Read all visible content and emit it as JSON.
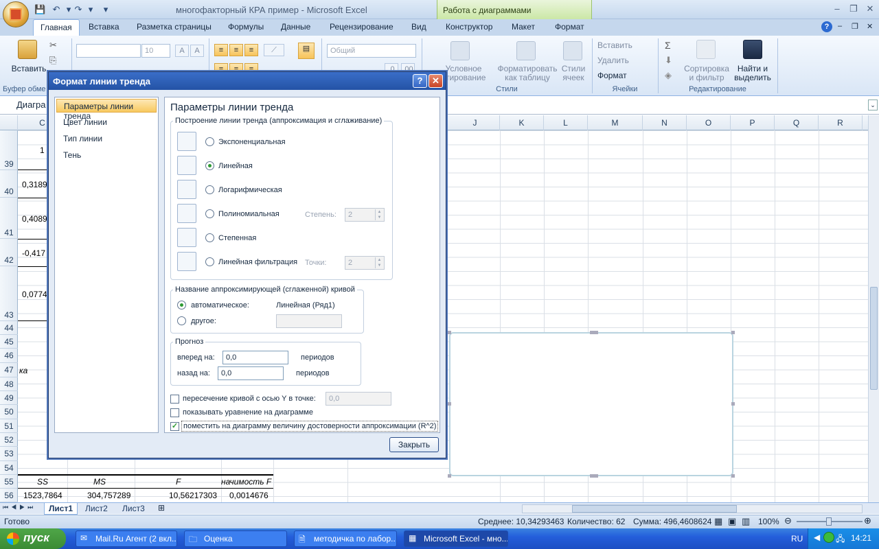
{
  "title_bar": {
    "app_title": "многофакторный КРА пример - Microsoft Excel",
    "context_tab": "Работа с диаграммами"
  },
  "tabs": [
    "Главная",
    "Вставка",
    "Разметка страницы",
    "Формулы",
    "Данные",
    "Рецензирование",
    "Вид",
    "Конструктор",
    "Макет",
    "Формат"
  ],
  "ribbon": {
    "paste": "Вставить",
    "clipboard_group": "Буфер обме",
    "font_size": "10",
    "number_format": "Общий",
    "cond_format": "Условное\nатирование",
    "format_table": "Форматировать\nкак таблицу",
    "cell_styles": "Стили\nячеек",
    "styles_group": "Стили",
    "insert": "Вставить",
    "delete": "Удалить",
    "format": "Формат",
    "cells_group": "Ячейки",
    "sort_filter": "Сортировка\nи фильтр",
    "find_select": "Найти и\nвыделить",
    "editing_group": "Редактирование"
  },
  "formula_bar": {
    "name_box": "Диагра"
  },
  "columns": [
    "C",
    "J",
    "K",
    "L",
    "M",
    "N",
    "O",
    "P",
    "Q",
    "R"
  ],
  "rows": [
    "39",
    "40",
    "41",
    "42",
    "43",
    "44",
    "45",
    "46",
    "47",
    "48",
    "49",
    "50",
    "51",
    "52",
    "53",
    "54",
    "55",
    "56"
  ],
  "cells": {
    "c39": "1",
    "c40": "0,3189",
    "c41": "0,4089",
    "c42": "-0,417",
    "c43": "0,0774",
    "c47": "ка",
    "h55_ss": "SS",
    "h55_ms": "MS",
    "h55_f": "F",
    "h55_sig": "начимость F",
    "r56_ss": "1523,7864",
    "r56_ms": "304,757289",
    "r56_f": "10,56217303",
    "r56_sig": "0,0014676"
  },
  "sheets": [
    "Лист1",
    "Лист2",
    "Лист3"
  ],
  "status": {
    "ready": "Готово",
    "average": "Среднее: 10,34293463",
    "count": "Количество: 62",
    "sum": "Сумма: 496,4608624",
    "zoom": "100%"
  },
  "taskbar": {
    "start": "пуск",
    "items": [
      "Mail.Ru Агент (2 вкл...",
      "Оценка",
      "методичка по лабор...",
      "Microsoft Excel - мно..."
    ],
    "lang": "RU",
    "time": "14:21"
  },
  "dialog": {
    "title": "Формат линии тренда",
    "help": "?",
    "close_x": "✕",
    "nav": [
      "Параметры линии тренда",
      "Цвет линии",
      "Тип линии",
      "Тень"
    ],
    "heading": "Параметры линии тренда",
    "group_type": "Построение линии тренда (аппроксимация и сглаживание)",
    "types": [
      "Экспоненциальная",
      "Линейная",
      "Логарифмическая",
      "Полиномиальная",
      "Степенная",
      "Линейная фильтрация"
    ],
    "selected_type": "Линейная",
    "degree_label": "Степень:",
    "degree_value": "2",
    "points_label": "Точки:",
    "points_value": "2",
    "group_name": "Название аппроксимирующей (сглаженной) кривой",
    "auto_label": "автоматическое:",
    "auto_value": "Линейная (Ряд1)",
    "other_label": "другое:",
    "group_forecast": "Прогноз",
    "forward_label": "вперед на:",
    "forward_value": "0,0",
    "forward_unit": "периодов",
    "back_label": "назад на:",
    "back_value": "0,0",
    "back_unit": "периодов",
    "intercept_label": "пересечение кривой с осью Y в точке:",
    "intercept_value": "0,0",
    "show_eq_label": "показывать уравнение на диаграмме",
    "show_r2_label": "поместить на диаграмму величину достоверности аппроксимации (R^2)",
    "close_button": "Закрыть"
  }
}
